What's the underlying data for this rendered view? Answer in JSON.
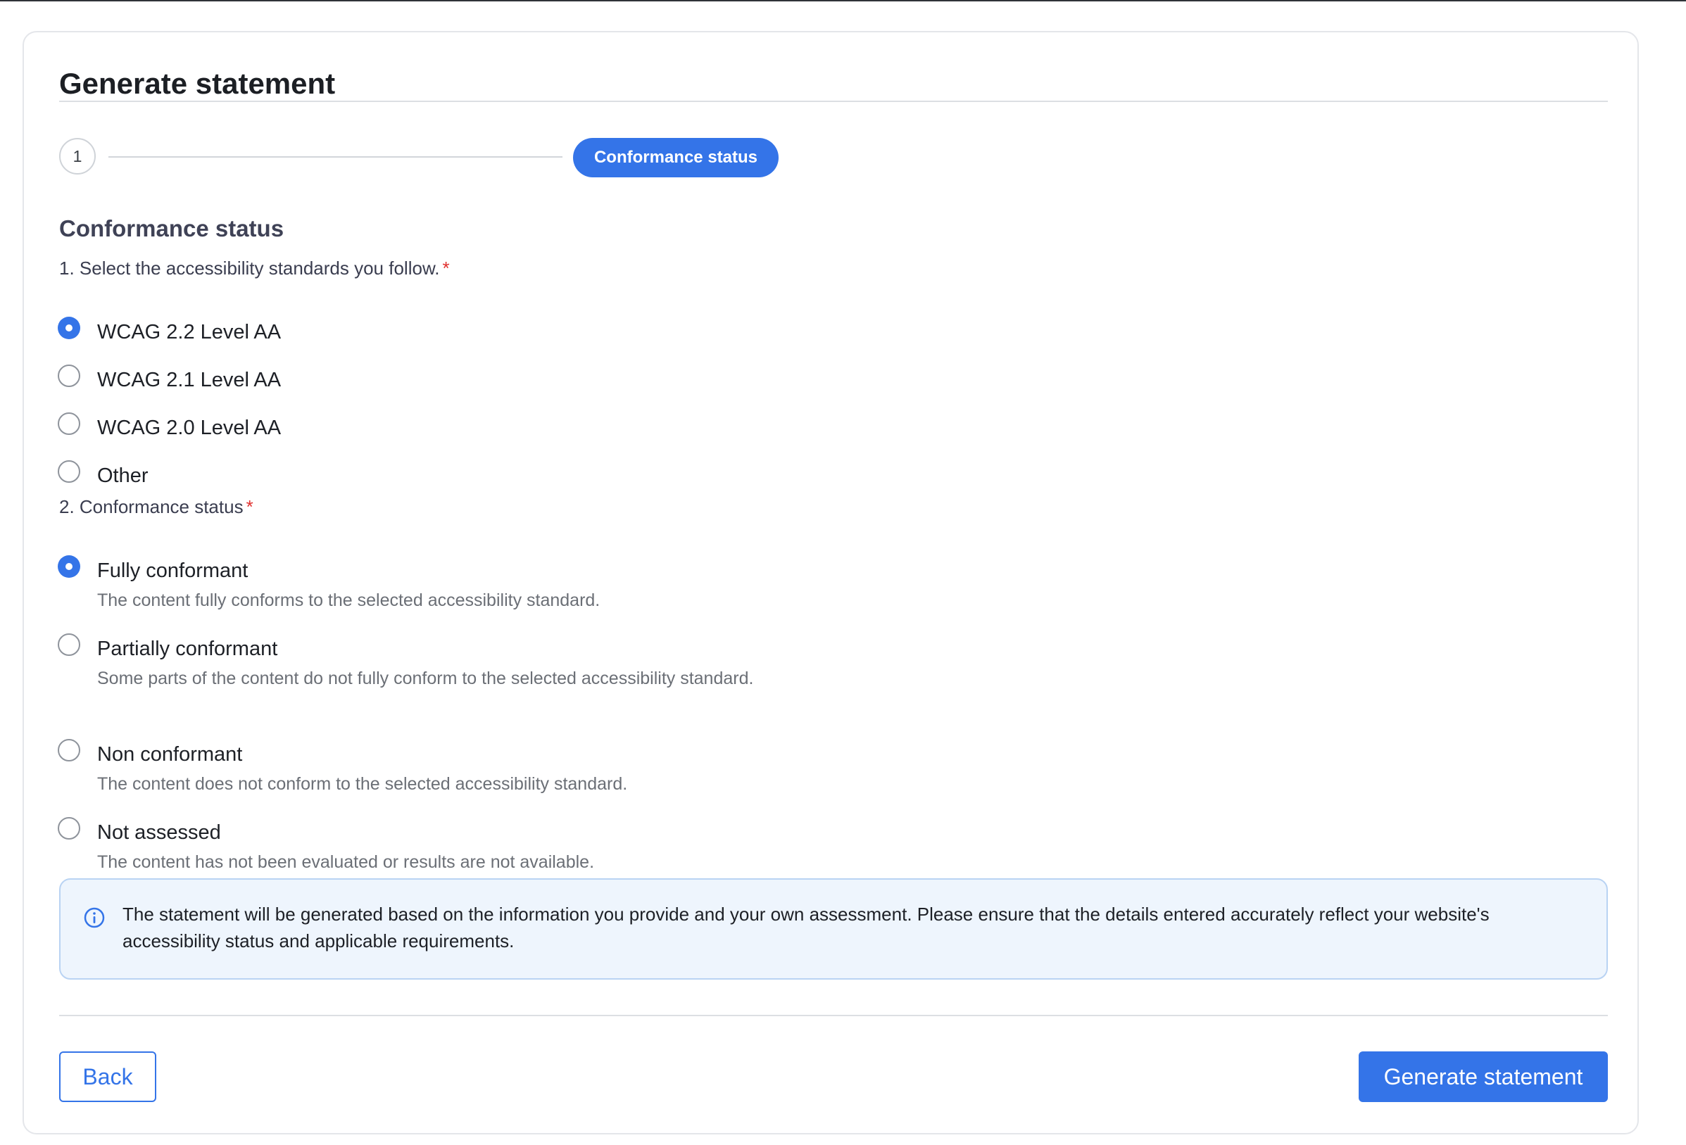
{
  "page": {
    "title": "Generate statement"
  },
  "stepper": {
    "step1_number": "1",
    "current_step_label": "Conformance status"
  },
  "section": {
    "heading": "Conformance status"
  },
  "question1": {
    "label": "1. Select the accessibility standards you follow.",
    "required_mark": "*",
    "options": [
      {
        "label": "WCAG 2.2 Level AA",
        "checked": true
      },
      {
        "label": "WCAG 2.1 Level AA",
        "checked": false
      },
      {
        "label": "WCAG 2.0 Level AA",
        "checked": false
      },
      {
        "label": "Other",
        "checked": false
      }
    ]
  },
  "question2": {
    "label": "2. Conformance status",
    "required_mark": "*",
    "options": [
      {
        "label": "Fully conformant",
        "description": "The content fully conforms to the selected accessibility standard.",
        "checked": true
      },
      {
        "label": "Partially conformant",
        "description": "Some parts of the content do not fully conform to the selected accessibility standard.",
        "checked": false
      },
      {
        "label": "Non conformant",
        "description": "The content does not conform to the selected accessibility standard.",
        "checked": false
      },
      {
        "label": "Not assessed",
        "description": "The content has not been evaluated or results are not available.",
        "checked": false
      }
    ]
  },
  "info": {
    "icon": "info-circle-icon",
    "text": "The statement will be generated based on the information you provide and your own assessment. Please ensure that the details entered accurately reflect your website's accessibility status and applicable requirements."
  },
  "footer": {
    "back_label": "Back",
    "generate_label": "Generate statement"
  },
  "colors": {
    "accent": "#3474e8",
    "required": "#e0312f",
    "info_background": "#eef5fd"
  }
}
